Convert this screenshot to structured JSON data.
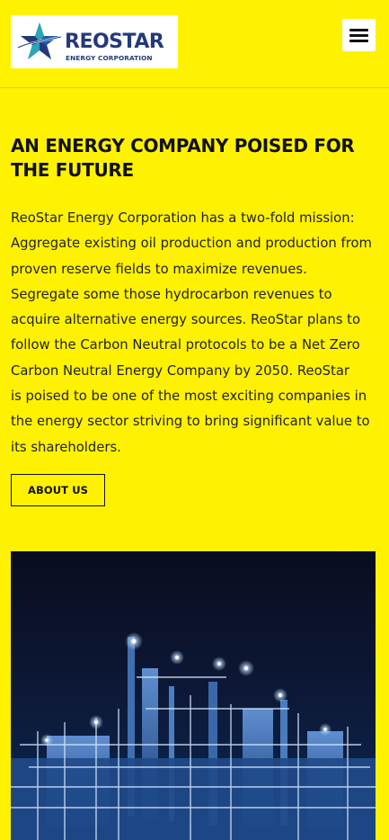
{
  "header": {
    "logo": {
      "name": "REOSTAR",
      "subtitle": "ENERGY CORPORATION",
      "colors": {
        "navy": "#24397b",
        "blue": "#3d7cc9",
        "teal": "#2aa6b8"
      }
    },
    "menu_icon": "hamburger-menu-icon"
  },
  "hero": {
    "heading": "AN ENERGY COMPANY POISED FOR THE FUTURE",
    "body_lines": [
      "ReoStar Energy Corporation has a two-fold mission:",
      "Aggregate existing oil production and production from",
      "proven reserve fields to maximize revenues.",
      "Segregate some those hydrocarbon revenues to",
      "acquire alternative energy sources. ReoStar plans to",
      "follow the Carbon Neutral protocols to be a Net Zero",
      "Carbon Neutral Energy Company by 2050. ReoStar",
      "is poised to be one of the most exciting companies in",
      "the energy sector striving to bring significant value to",
      "its shareholders."
    ],
    "button_label": "ABOUT US"
  },
  "image": {
    "subject": "refinery-at-night-image"
  },
  "colors": {
    "background": "#fff200",
    "text": "#111111"
  }
}
